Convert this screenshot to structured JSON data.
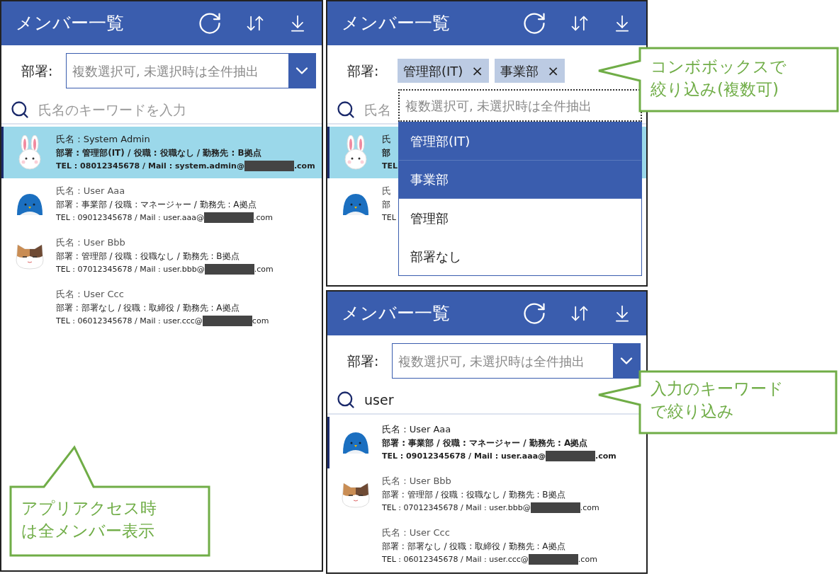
{
  "screens": [
    {
      "title": "メンバー一覧",
      "department": {
        "label": "部署:",
        "placeholder": "複数選択可, 未選択時は全件抽出"
      },
      "search": {
        "placeholder": "氏名のキーワードを入力"
      },
      "members": [
        {
          "kind": "rabbit",
          "selected": true,
          "highlighted": true,
          "name": "氏名 : System Admin",
          "dept": "部署 : 管理部(IT) / 役職 : 役職なし / 勤務先 : B拠点",
          "contact": "TEL : 08012345678 / Mail : system.admin@",
          "contact_end": ".com"
        },
        {
          "kind": "penguin",
          "selected": false,
          "highlighted": false,
          "name": "氏名 : User Aaa",
          "dept": "部署 : 事業部 / 役職 : マネージャー / 勤務先 : A拠点",
          "contact": "TEL : 09012345678 / Mail : user.aaa@",
          "contact_end": ".com"
        },
        {
          "kind": "cat",
          "selected": false,
          "highlighted": false,
          "name": "氏名 : User Bbb",
          "dept": "部署 : 管理部 / 役職 : 役職なし / 勤務先 : B拠点",
          "contact": "TEL : 07012345678 / Mail : user.bbb@",
          "contact_end": ".com"
        },
        {
          "selected": false,
          "highlighted": false,
          "name": "氏名 : User Ccc",
          "dept": "部署 : 部署なし / 役職 : 取締役 / 勤務先 : A拠点",
          "contact": "TEL : 06012345678 / Mail : user.ccc@",
          "contact_end": "com"
        }
      ]
    },
    {
      "title": "メンバー一覧",
      "department": {
        "label": "部署:",
        "chips": [
          "管理部(IT)",
          "事業部"
        ],
        "chip_remove": "×",
        "placeholder": "複数選択可, 未選択時は全件抽出",
        "options": [
          {
            "label": "管理部(IT)",
            "selected": true
          },
          {
            "label": "事業部",
            "selected": true
          },
          {
            "label": "管理部",
            "selected": false
          },
          {
            "label": "部署なし",
            "selected": false
          }
        ]
      },
      "search": {
        "placeholder": "氏名"
      },
      "members": [
        {
          "kind": "rabbit",
          "selected": true,
          "highlighted": true,
          "name": "氏",
          "dept": "部",
          "contact": "TEL"
        },
        {
          "kind": "penguin",
          "selected": false,
          "highlighted": false,
          "name": "氏",
          "dept": "部",
          "contact": "TEL"
        }
      ]
    },
    {
      "title": "メンバー一覧",
      "department": {
        "label": "部署:",
        "placeholder": "複数選択可, 未選択時は全件抽出"
      },
      "search": {
        "value": "user"
      },
      "members": [
        {
          "kind": "penguin",
          "selected": true,
          "highlighted": false,
          "name": "氏名 : User Aaa",
          "dept": "部署 : 事業部 / 役職 : マネージャー / 勤務先 : A拠点",
          "contact": "TEL : 09012345678 / Mail : user.aaa@",
          "contact_end": ".com"
        },
        {
          "kind": "cat",
          "selected": false,
          "highlighted": false,
          "name": "氏名 : User Bbb",
          "dept": "部署 : 管理部 / 役職 : 役職なし / 勤務先 : B拠点",
          "contact": "TEL : 07012345678 / Mail : user.bbb@",
          "contact_end": ".com"
        },
        {
          "selected": false,
          "highlighted": false,
          "name": "氏名 : User Ccc",
          "dept": "部署 : 部署なし / 役職 : 取締役 / 勤務先 : A拠点",
          "contact": "TEL : 06012345678 / Mail : user.ccc@",
          "contact_end": ".com"
        }
      ]
    }
  ],
  "callouts": [
    {
      "lines": [
        "コンボボックスで",
        "絞り込み(複数可)"
      ]
    },
    {
      "lines": [
        "入力のキーワード",
        "で絞り込み"
      ]
    },
    {
      "lines": [
        "アプリアクセス時",
        "は全メンバー表示"
      ]
    }
  ]
}
